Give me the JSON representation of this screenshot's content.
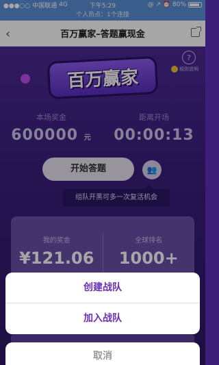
{
  "status_bar": {
    "carrier": "●●●○○ 中国联通",
    "network": "4G",
    "time": "下午5:29",
    "right_icons": "@ ↗ ⏰ 80%",
    "hotspot_text": "个人热点：1个连接"
  },
  "nav": {
    "back_icon": "chevron-left",
    "title": "百万赢家–答题赢现金",
    "share_icon": "share-icon"
  },
  "main": {
    "rules_label": "规则说明",
    "logo_text": "百万赢家",
    "prize_label": "本场奖金",
    "prize_value": "600000",
    "prize_unit": "元",
    "countdown_label": "距离开场",
    "countdown_value": "00:00:13",
    "start_button": "开始答题",
    "tip_text": "组队开黑可多一次复活机会",
    "my_prize_label": "我的奖金",
    "my_prize_value": "¥121.06",
    "rank_label": "全球排名",
    "rank_value": "1000+"
  },
  "action_sheet": {
    "items": [
      "创建战队",
      "加入战队"
    ],
    "cancel": "取消"
  },
  "colors": {
    "accent": "#6a2fb5",
    "background": "#3b1f78",
    "status_bar": "#5b8fd6"
  }
}
